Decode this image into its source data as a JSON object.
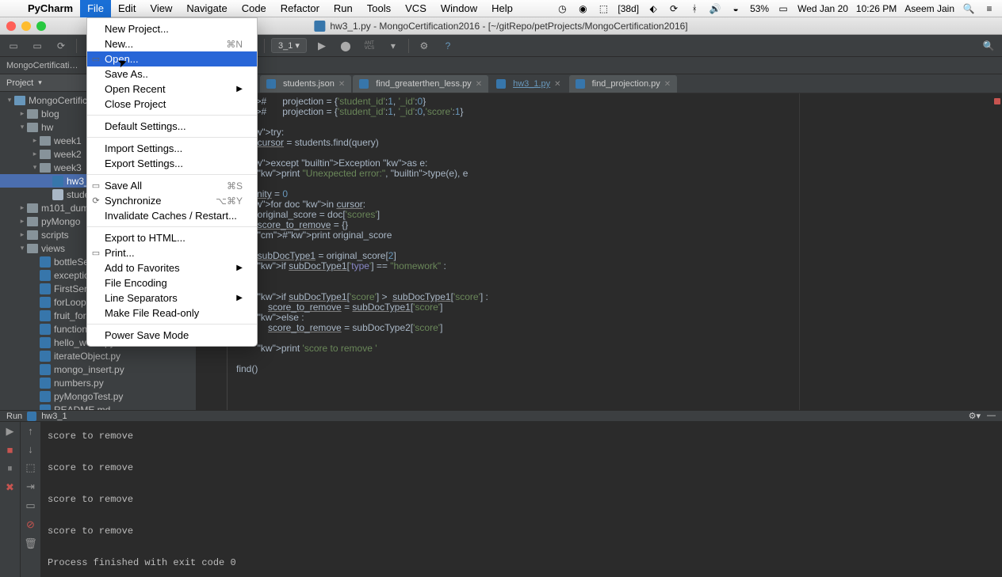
{
  "mac_menu": {
    "app": "PyCharm",
    "items": [
      "File",
      "Edit",
      "View",
      "Navigate",
      "Code",
      "Refactor",
      "Run",
      "Tools",
      "VCS",
      "Window",
      "Help"
    ],
    "open_index": 0
  },
  "mac_status": {
    "percent": "53%",
    "day_date": "Wed Jan 20",
    "time": "10:26 PM",
    "user": "Aseem Jain",
    "battery_icon": "battery-icon",
    "d38": "[38d]"
  },
  "window": {
    "title": "hw3_1.py - MongoCertification2016 - [~/gitRepo/petProjects/MongoCertification2016]"
  },
  "toolbar": {
    "run_config": "3_1 ▾"
  },
  "breadcrumb": [
    "MongoCertificati…"
  ],
  "sidebar": {
    "header": "Project",
    "tree": [
      {
        "indent": 0,
        "tw": "▾",
        "icon": "proj",
        "label": "MongoCertification2016"
      },
      {
        "indent": 1,
        "tw": "▸",
        "icon": "folder",
        "label": "blog"
      },
      {
        "indent": 1,
        "tw": "▾",
        "icon": "folder",
        "label": "hw"
      },
      {
        "indent": 2,
        "tw": "▸",
        "icon": "folder",
        "label": "week1"
      },
      {
        "indent": 2,
        "tw": "▸",
        "icon": "folder",
        "label": "week2"
      },
      {
        "indent": 2,
        "tw": "▾",
        "icon": "folder",
        "label": "week3"
      },
      {
        "indent": 3,
        "tw": "",
        "icon": "py",
        "label": "hw3_",
        "sel": true
      },
      {
        "indent": 3,
        "tw": "",
        "icon": "json",
        "label": "stude"
      },
      {
        "indent": 1,
        "tw": "▸",
        "icon": "folder",
        "label": "m101_dum"
      },
      {
        "indent": 1,
        "tw": "▸",
        "icon": "folder",
        "label": "pyMongo"
      },
      {
        "indent": 1,
        "tw": "▸",
        "icon": "folder",
        "label": "scripts"
      },
      {
        "indent": 1,
        "tw": "▾",
        "icon": "folder",
        "label": "views"
      },
      {
        "indent": 2,
        "tw": "",
        "icon": "py",
        "label": "bottleServer"
      },
      {
        "indent": 2,
        "tw": "",
        "icon": "py",
        "label": "exception_h"
      },
      {
        "indent": 2,
        "tw": "",
        "icon": "py",
        "label": "FirstServer."
      },
      {
        "indent": 2,
        "tw": "",
        "icon": "py",
        "label": "forLoop.py"
      },
      {
        "indent": 2,
        "tw": "",
        "icon": "py",
        "label": "fruit_form.p"
      },
      {
        "indent": 2,
        "tw": "",
        "icon": "py",
        "label": "functionDef"
      },
      {
        "indent": 2,
        "tw": "",
        "icon": "py",
        "label": "hello_world.py"
      },
      {
        "indent": 2,
        "tw": "",
        "icon": "py",
        "label": "iterateObject.py"
      },
      {
        "indent": 2,
        "tw": "",
        "icon": "py",
        "label": "mongo_insert.py"
      },
      {
        "indent": 2,
        "tw": "",
        "icon": "py",
        "label": "numbers.py"
      },
      {
        "indent": 2,
        "tw": "",
        "icon": "py",
        "label": "pyMongoTest.py"
      },
      {
        "indent": 2,
        "tw": "",
        "icon": "py",
        "label": "README.md"
      }
    ]
  },
  "tabs": [
    {
      "label": "students.json",
      "active": false,
      "mod": false
    },
    {
      "label": "find_greaterthen_less.py",
      "active": false,
      "mod": false
    },
    {
      "label": "hw3_1.py",
      "active": true,
      "mod": true
    },
    {
      "label": "find_projection.py",
      "active": false,
      "mod": false
    }
  ],
  "code_lines": [
    "#      projection = {'student_id':1, '_id':0}",
    "#      projection = {'student_id':1, '_id':0,'score':1}",
    "",
    "    try:",
    "        cursor = students.find(query)",
    "",
    "    except Exception as e:",
    "        print \"Unexpected error:\", type(e), e",
    "",
    "    sanity = 0",
    "    for doc in cursor:",
    "        original_score = doc['scores']",
    "        score_to_remove = {}",
    "        #print original_score",
    "",
    "        subDocType1 = original_score[2]",
    "        if subDocType1['type'] == \"homework\" :",
    "",
    "",
    "        if subDocType1['score'] >  subDocType1['score'] :",
    "            score_to_remove = subDocType1['score']",
    "        else :",
    "            score_to_remove = subDocType2['score']",
    "",
    "        print 'score to remove '",
    "",
    "find()"
  ],
  "file_menu": [
    {
      "label": "New Project..."
    },
    {
      "label": "New...",
      "shortcut": "⌘N",
      "icon": ""
    },
    {
      "label": "Open...",
      "hl": true,
      "icon": "▭"
    },
    {
      "label": "Save As..",
      "icon": ""
    },
    {
      "label": "Open Recent",
      "sub": "▶"
    },
    {
      "label": "Close Project"
    },
    {
      "sep": true
    },
    {
      "label": "Default Settings..."
    },
    {
      "sep": true
    },
    {
      "label": "Import Settings..."
    },
    {
      "label": "Export Settings..."
    },
    {
      "sep": true
    },
    {
      "label": "Save All",
      "shortcut": "⌘S",
      "icon": "▭"
    },
    {
      "label": "Synchronize",
      "shortcut": "⌥⌘Y",
      "icon": "⟳"
    },
    {
      "label": "Invalidate Caches / Restart..."
    },
    {
      "sep": true
    },
    {
      "label": "Export to HTML..."
    },
    {
      "label": "Print...",
      "icon": "▭"
    },
    {
      "label": "Add to Favorites",
      "sub": "▶"
    },
    {
      "label": "File Encoding"
    },
    {
      "label": "Line Separators",
      "sub": "▶"
    },
    {
      "label": "Make File Read-only"
    },
    {
      "sep": true
    },
    {
      "label": "Power Save Mode"
    }
  ],
  "run": {
    "header": "Run",
    "config": "hw3_1",
    "lines": [
      "score to remove ",
      "",
      "score to remove ",
      "",
      "score to remove ",
      "",
      "score to remove ",
      "",
      "Process finished with exit code 0"
    ]
  }
}
